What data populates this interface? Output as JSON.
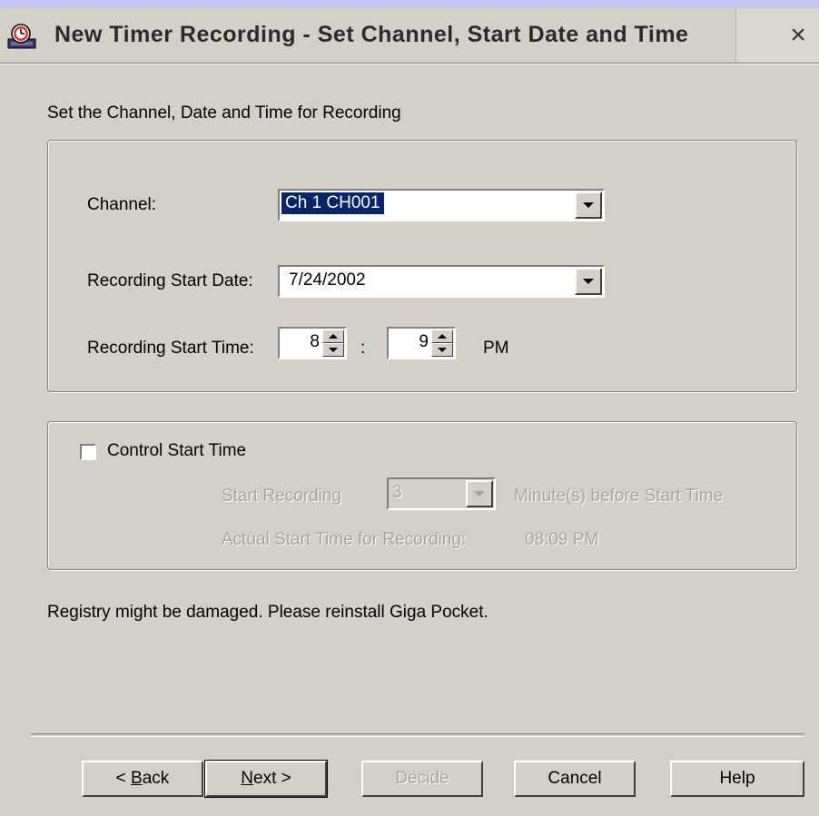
{
  "window": {
    "title": "New Timer Recording - Set Channel, Start Date and Time",
    "close_label": "×"
  },
  "instructions": "Set the Channel, Date and Time for Recording",
  "form": {
    "channel_label": "Channel:",
    "channel_value": "Ch 1 CH001",
    "date_label": "Recording Start Date:",
    "date_value": "7/24/2002",
    "time_label": "Recording Start Time:",
    "hour_value": "8",
    "colon": ":",
    "minute_value": "9",
    "ampm": "PM"
  },
  "control": {
    "checkbox_label": "Control Start Time",
    "checked": false,
    "start_recording_label": "Start Recording",
    "minutes_value": "3",
    "minutes_suffix": "Minute(s) before Start Time",
    "actual_label": "Actual Start Time for Recording:",
    "actual_value": "08:09 PM"
  },
  "message": "Registry might be damaged. Please reinstall Giga Pocket.",
  "buttons": {
    "back_prefix": "< ",
    "back_accel": "B",
    "back_rest": "ack",
    "next_accel": "N",
    "next_rest": "ext >",
    "decide": "Decide",
    "cancel": "Cancel",
    "help": "Help"
  },
  "colors": {
    "dialog_bg": "#d4d0c8",
    "selection": "#0a246a",
    "disabled_text": "#a8a49c"
  },
  "icons": {
    "app": "clock-record-icon",
    "close": "close-icon",
    "dropdown": "chevron-down-icon",
    "spin": "spin-updown-icon"
  }
}
